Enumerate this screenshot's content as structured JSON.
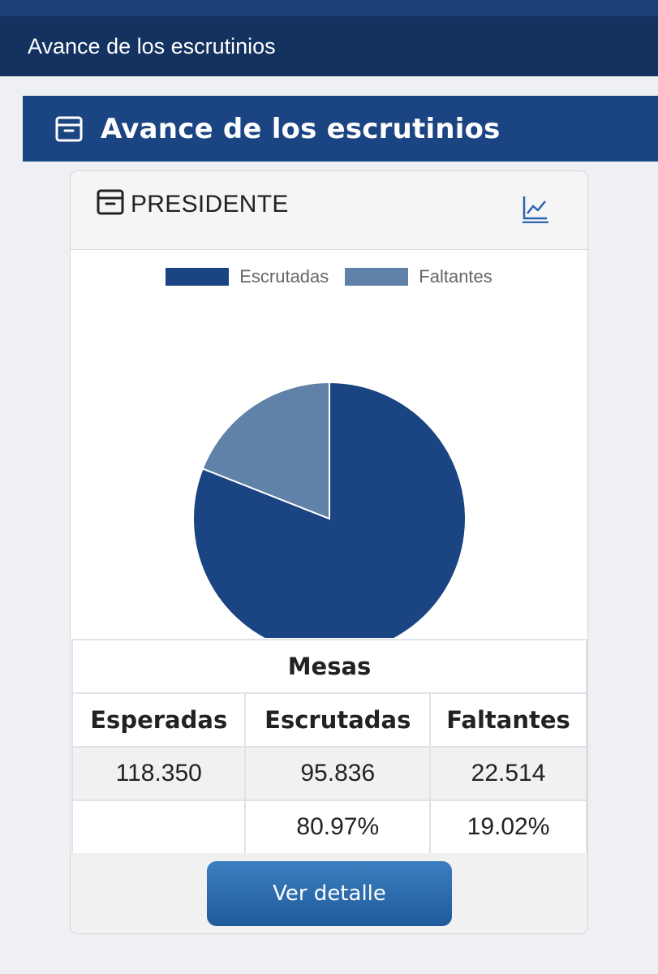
{
  "topbar": {
    "title": "Avance de los escrutinios"
  },
  "section": {
    "title": "Avance de los escrutinios",
    "icon": "archive-box-icon"
  },
  "card": {
    "title": "PRESIDENTE",
    "icon": "archive-box-icon",
    "action_icon": "line-chart-icon",
    "accent_color": "#2b64b0"
  },
  "chart_data": {
    "type": "pie",
    "categories": [
      "Escrutadas",
      "Faltantes"
    ],
    "values": [
      95836,
      22514
    ],
    "colors": [
      "#1b4582",
      "#6081a8"
    ],
    "legend": "top"
  },
  "table": {
    "header": "Mesas",
    "columns": [
      "Esperadas",
      "Escrutadas",
      "Faltantes"
    ],
    "rows": [
      [
        "118.350",
        "95.836",
        "22.514"
      ],
      [
        "",
        "80.97%",
        "19.02%"
      ]
    ]
  },
  "button": {
    "label": "Ver detalle"
  }
}
